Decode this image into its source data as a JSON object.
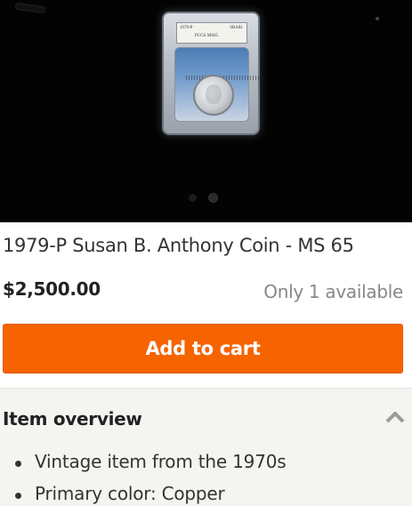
{
  "listing": {
    "title": "1979-P Susan B. Anthony Coin - MS 65",
    "price": "$2,500.00",
    "availability": "Only 1 available"
  },
  "gallery": {
    "slab_label": {
      "year": "1979-P",
      "grader": "PCGS MS65",
      "grade": "SBA$1"
    },
    "dot_count": 2,
    "active_index": 1
  },
  "cart": {
    "button_label": "Add to cart"
  },
  "overview": {
    "heading": "Item overview",
    "items": [
      "Vintage item from the 1970s",
      "Primary color: Copper"
    ]
  },
  "colors": {
    "accent": "#f56400",
    "panel_bg": "#f4f4f1"
  }
}
